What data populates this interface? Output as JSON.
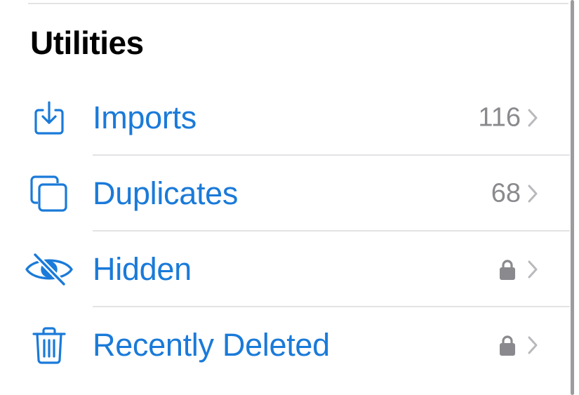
{
  "section": {
    "title": "Utilities"
  },
  "items": [
    {
      "label": "Imports",
      "count": "116",
      "icon": "import-icon",
      "locked": false
    },
    {
      "label": "Duplicates",
      "count": "68",
      "icon": "duplicates-icon",
      "locked": false
    },
    {
      "label": "Hidden",
      "count": "",
      "icon": "eye-slash-icon",
      "locked": true
    },
    {
      "label": "Recently Deleted",
      "count": "",
      "icon": "trash-icon",
      "locked": true
    }
  ],
  "colors": {
    "accent": "#1a7ad9",
    "secondary_text": "#8a8a8e",
    "separator": "#e3e3e6",
    "chevron": "#b9b9bd"
  }
}
